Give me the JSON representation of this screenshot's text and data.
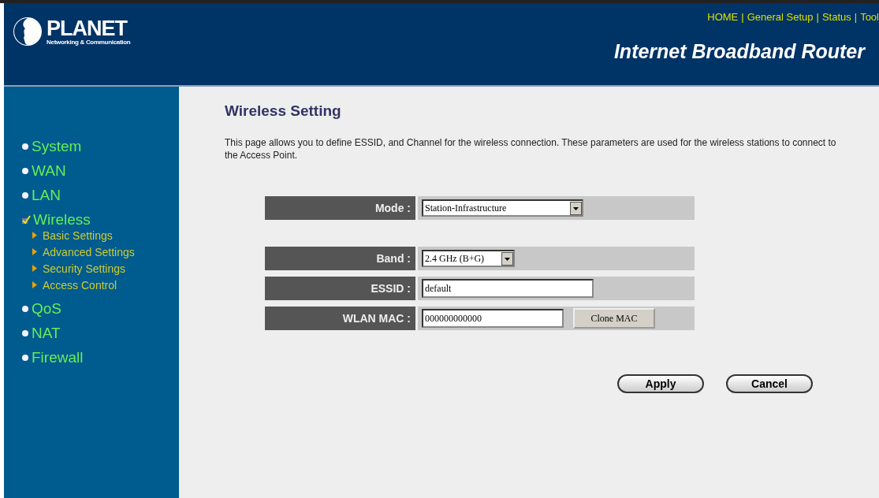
{
  "logo": {
    "name": "PLANET",
    "tagline": "Networking & Communication"
  },
  "top_links": [
    "HOME",
    "General Setup",
    "Status",
    "Tool"
  ],
  "top_link_separator": "|",
  "header_title": "Internet Broadband Router",
  "sidebar": {
    "items": [
      {
        "label": "System",
        "selected": false
      },
      {
        "label": "WAN",
        "selected": false
      },
      {
        "label": "LAN",
        "selected": false
      },
      {
        "label": "Wireless",
        "selected": true,
        "children": [
          {
            "label": "Basic Settings"
          },
          {
            "label": "Advanced Settings"
          },
          {
            "label": "Security Settings"
          },
          {
            "label": "Access Control"
          }
        ]
      },
      {
        "label": "QoS",
        "selected": false
      },
      {
        "label": "NAT",
        "selected": false
      },
      {
        "label": "Firewall",
        "selected": false
      }
    ]
  },
  "page": {
    "title": "Wireless Setting",
    "description": "This page allows you to define ESSID, and Channel for the wireless connection. These parameters are used for the wireless stations to connect to the Access Point."
  },
  "form": [
    {
      "kind": "select",
      "label": "Mode :",
      "value": "Station-Infrastructure"
    },
    {
      "kind": "select",
      "label": "Band :",
      "value": "2.4 GHz (B+G)"
    },
    {
      "kind": "input",
      "label": "ESSID :",
      "value": "default"
    },
    {
      "kind": "input_button",
      "label": "WLAN MAC :",
      "value": "000000000000",
      "button": "Clone MAC"
    }
  ],
  "buttons": [
    "Apply",
    "Cancel"
  ]
}
